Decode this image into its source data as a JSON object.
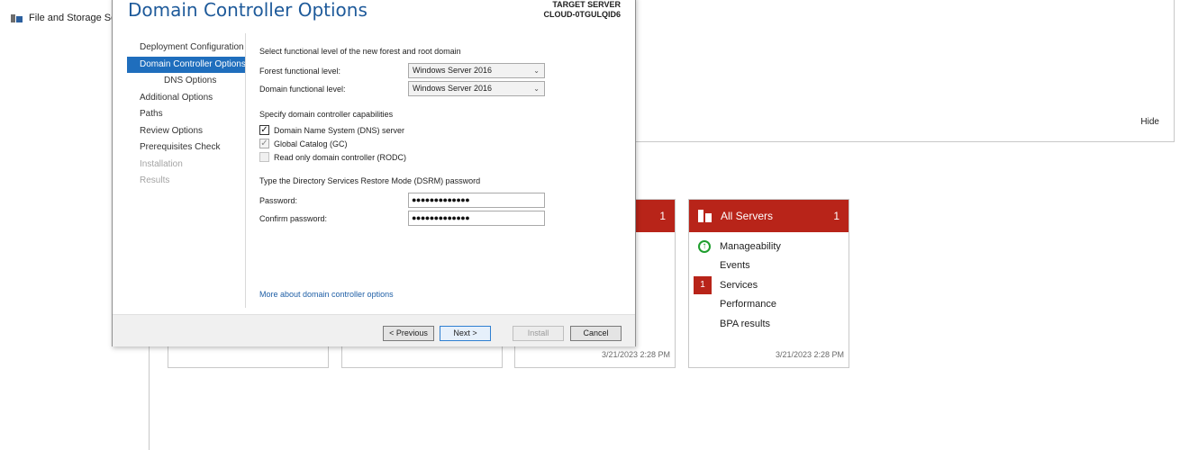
{
  "background": {
    "nav_label": "File and Storage Ser",
    "hide_label": "Hide",
    "tiles": [
      {
        "title": "",
        "count": "1",
        "timestamp": "3/21/2023 2:28 PM"
      },
      {
        "title": "All Servers",
        "count": "1",
        "rows": [
          {
            "label": "Manageability",
            "badge": "up"
          },
          {
            "label": "Events",
            "badge": ""
          },
          {
            "label": "Services",
            "badge": "1"
          },
          {
            "label": "Performance",
            "badge": ""
          },
          {
            "label": "BPA results",
            "badge": ""
          }
        ],
        "timestamp": "3/21/2023 2:28 PM"
      }
    ]
  },
  "dialog": {
    "title": "Domain Controller Options",
    "target_label": "TARGET SERVER",
    "target_name": "CLOUD-0TGULQID6",
    "steps": [
      {
        "label": "Deployment Configuration",
        "state": "normal"
      },
      {
        "label": "Domain Controller Options",
        "state": "active"
      },
      {
        "label": "DNS Options",
        "state": "sub"
      },
      {
        "label": "Additional Options",
        "state": "normal"
      },
      {
        "label": "Paths",
        "state": "normal"
      },
      {
        "label": "Review Options",
        "state": "normal"
      },
      {
        "label": "Prerequisites Check",
        "state": "normal"
      },
      {
        "label": "Installation",
        "state": "disabled"
      },
      {
        "label": "Results",
        "state": "disabled"
      }
    ],
    "functional_level_heading": "Select functional level of the new forest and root domain",
    "forest_label": "Forest functional level:",
    "forest_value": "Windows Server 2016",
    "domain_label": "Domain functional level:",
    "domain_value": "Windows Server 2016",
    "capabilities_heading": "Specify domain controller capabilities",
    "capabilities": [
      {
        "label": "Domain Name System (DNS) server",
        "checked": true,
        "enabled": true
      },
      {
        "label": "Global Catalog (GC)",
        "checked": true,
        "enabled": false
      },
      {
        "label": "Read only domain controller (RODC)",
        "checked": false,
        "enabled": false
      }
    ],
    "dsrm_heading": "Type the Directory Services Restore Mode (DSRM) password",
    "password_label": "Password:",
    "password_value": "●●●●●●●●●●●●●",
    "confirm_label": "Confirm password:",
    "confirm_value": "●●●●●●●●●●●●●",
    "more_link": "More about domain controller options",
    "buttons": {
      "previous": "< Previous",
      "next": "Next >",
      "install": "Install",
      "cancel": "Cancel"
    }
  }
}
